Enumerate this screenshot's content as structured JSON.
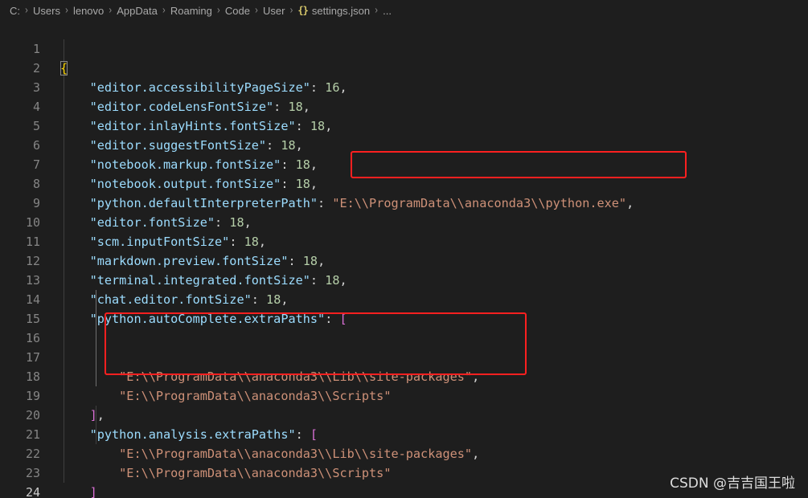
{
  "breadcrumb": {
    "segments": [
      "C:",
      "Users",
      "lenovo",
      "AppData",
      "Roaming",
      "Code",
      "User"
    ],
    "file_icon": "braces-icon",
    "file_name": "settings.json",
    "trailing": "..."
  },
  "editor": {
    "active_line": 24,
    "lines": [
      {
        "n": "1",
        "open": "{"
      },
      {
        "n": "2",
        "key": "\"editor.accessibilityPageSize\"",
        "val": "16",
        "type": "num"
      },
      {
        "n": "3",
        "key": "\"editor.codeLensFontSize\"",
        "val": "18",
        "type": "num"
      },
      {
        "n": "4",
        "key": "\"editor.inlayHints.fontSize\"",
        "val": "18",
        "type": "num"
      },
      {
        "n": "5",
        "key": "\"editor.suggestFontSize\"",
        "val": "18",
        "type": "num"
      },
      {
        "n": "6",
        "key": "\"notebook.markup.fontSize\"",
        "val": "18",
        "type": "num"
      },
      {
        "n": "7",
        "key": "\"notebook.output.fontSize\"",
        "val": "18",
        "type": "num"
      },
      {
        "n": "8",
        "key": "\"python.defaultInterpreterPath\"",
        "val": "\"E:\\\\ProgramData\\\\anaconda3\\\\python.exe\"",
        "type": "str"
      },
      {
        "n": "9",
        "key": "\"editor.fontSize\"",
        "val": "18",
        "type": "num"
      },
      {
        "n": "10",
        "key": "\"scm.inputFontSize\"",
        "val": "18",
        "type": "num"
      },
      {
        "n": "11",
        "key": "\"markdown.preview.fontSize\"",
        "val": "18",
        "type": "num"
      },
      {
        "n": "12",
        "key": "\"terminal.integrated.fontSize\"",
        "val": "18",
        "type": "num"
      },
      {
        "n": "13",
        "key": "\"chat.editor.fontSize\"",
        "val": "18",
        "type": "num"
      },
      {
        "n": "14",
        "key": "\"python.autoComplete.extraPaths\"",
        "open": "["
      },
      {
        "n": "15"
      },
      {
        "n": "16"
      },
      {
        "n": "17",
        "item": "\"E:\\\\ProgramData\\\\anaconda3\\\\Lib\\\\site-packages\"",
        "comma": ","
      },
      {
        "n": "18",
        "item": "\"E:\\\\ProgramData\\\\anaconda3\\\\Scripts\""
      },
      {
        "n": "19",
        "close": "]",
        "comma": ","
      },
      {
        "n": "20",
        "key": "\"python.analysis.extraPaths\"",
        "open": "["
      },
      {
        "n": "21",
        "item": "\"E:\\\\ProgramData\\\\anaconda3\\\\Lib\\\\site-packages\"",
        "comma": ","
      },
      {
        "n": "22",
        "item": "\"E:\\\\ProgramData\\\\anaconda3\\\\Scripts\""
      },
      {
        "n": "23",
        "close": "]"
      },
      {
        "n": "24",
        "close": "}"
      }
    ]
  },
  "watermark": "CSDN @吉吉国王啦",
  "colors": {
    "background": "#1e1e1e",
    "key": "#9cdcfe",
    "number": "#b5cea8",
    "string": "#ce9178",
    "brace_level1": "#ffd700",
    "bracket_level2": "#da70d6",
    "annotation_box": "#ff2020"
  }
}
